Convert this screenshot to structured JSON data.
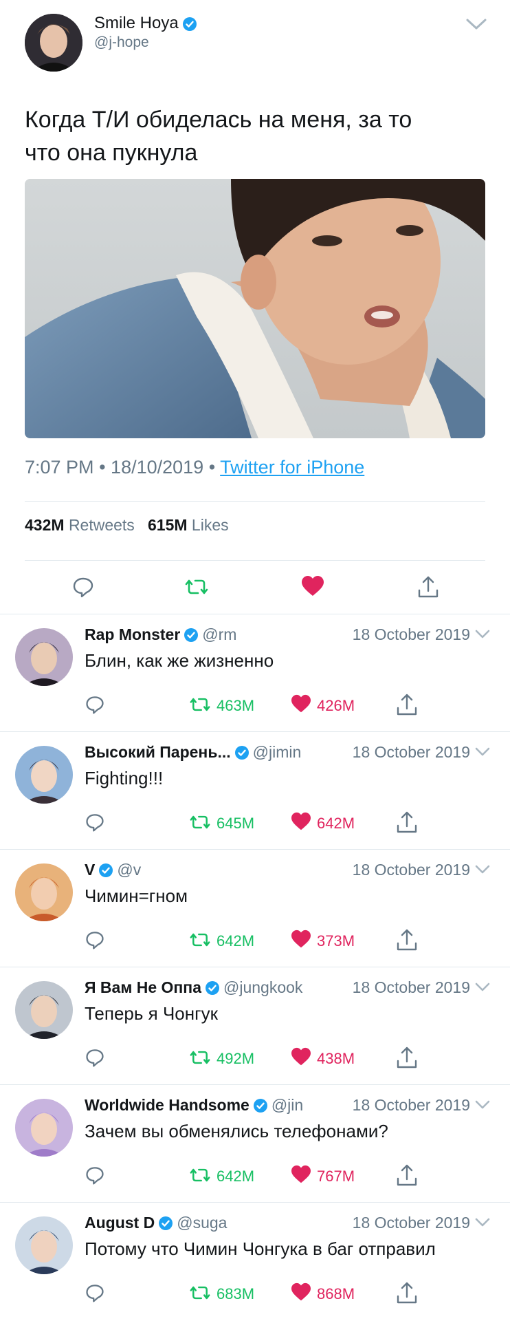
{
  "tweet": {
    "author_name": "Smile Hoya",
    "author_handle": "@j-hope",
    "text_line1": "Когда Т/И обиделась на меня, за то",
    "text_line2": "что она пукнула",
    "time": "7:07 PM",
    "date": "18/10/2019",
    "source": "Twitter for iPhone",
    "retweets_count": "432M",
    "retweets_label": "Retweets",
    "likes_count": "615M",
    "likes_label": "Likes"
  },
  "colors": {
    "verified": "#1da1f2",
    "retweet": "#17bf63",
    "like": "#e0245e",
    "muted": "#657786"
  },
  "replies": [
    {
      "name": "Rap Monster",
      "handle": "@rm",
      "date": "18 October 2019",
      "text": "Блин, как же жизненно",
      "retweets": "463M",
      "likes": "426M"
    },
    {
      "name": "Высокий Парень...",
      "handle": "@jimin",
      "date": "18 October 2019",
      "text": "Fighting!!!",
      "retweets": "645M",
      "likes": "642M"
    },
    {
      "name": "V",
      "handle": "@v",
      "date": "18 October 2019",
      "text": "Чимин=гном",
      "retweets": "642M",
      "likes": "373M"
    },
    {
      "name": "Я Вам Не Оппа",
      "handle": "@jungkook",
      "date": "18 October 2019",
      "text": "Теперь я Чонгук",
      "retweets": "492M",
      "likes": "438M"
    },
    {
      "name": "Worldwide Handsome",
      "handle": "@jin",
      "date": "18 October 2019",
      "text": "Зачем вы обменялись телефонами?",
      "retweets": "642M",
      "likes": "767M"
    },
    {
      "name": "August D",
      "handle": "@suga",
      "date": "18 October 2019",
      "text": "Потому что Чимин Чонгука в баг отправил",
      "retweets": "683M",
      "likes": "868M"
    }
  ]
}
